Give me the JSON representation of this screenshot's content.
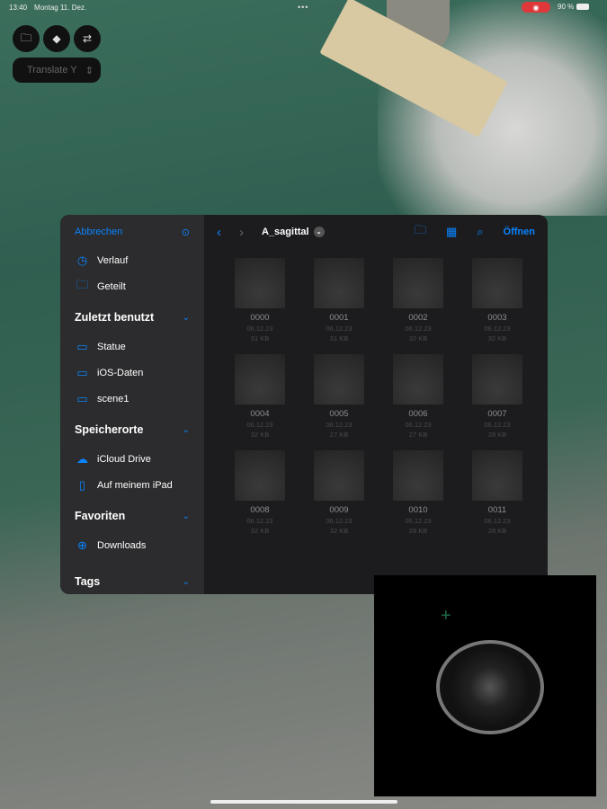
{
  "status_bar": {
    "time": "13:40",
    "date": "Montag 11. Dez.",
    "battery": "90 %"
  },
  "overlay": {
    "translate_label": "Translate Y"
  },
  "sidebar": {
    "cancel": "Abbrechen",
    "items": [
      {
        "label": "Verlauf",
        "icon": "clock-icon"
      },
      {
        "label": "Geteilt",
        "icon": "shared-folder-icon"
      }
    ],
    "recent": {
      "title": "Zuletzt benutzt",
      "items": [
        "Statue",
        "iOS-Daten",
        "scene1"
      ]
    },
    "locations": {
      "title": "Speicherorte",
      "items": [
        "iCloud Drive",
        "Auf meinem iPad"
      ]
    },
    "favorites": {
      "title": "Favoriten",
      "items": [
        "Downloads"
      ]
    },
    "tags": {
      "title": "Tags"
    }
  },
  "toolbar": {
    "folder": "A_sagittal",
    "open": "Öffnen"
  },
  "files": [
    {
      "name": "0000",
      "date": "06.12.23",
      "size": "31 KB"
    },
    {
      "name": "0001",
      "date": "06.12.23",
      "size": "31 KB"
    },
    {
      "name": "0002",
      "date": "06.12.23",
      "size": "32 KB"
    },
    {
      "name": "0003",
      "date": "06.12.23",
      "size": "32 KB"
    },
    {
      "name": "0004",
      "date": "06.12.23",
      "size": "32 KB"
    },
    {
      "name": "0005",
      "date": "06.12.23",
      "size": "27 KB"
    },
    {
      "name": "0006",
      "date": "06.12.23",
      "size": "27 KB"
    },
    {
      "name": "0007",
      "date": "06.12.23",
      "size": "28 KB"
    },
    {
      "name": "0008",
      "date": "06.12.23",
      "size": "32 KB"
    },
    {
      "name": "0009",
      "date": "06.12.23",
      "size": "32 KB"
    },
    {
      "name": "0010",
      "date": "06.12.23",
      "size": "28 KB"
    },
    {
      "name": "0011",
      "date": "06.12.23",
      "size": "28 KB"
    }
  ],
  "colors": {
    "accent": "#0a84ff",
    "recording": "#e0383a"
  }
}
